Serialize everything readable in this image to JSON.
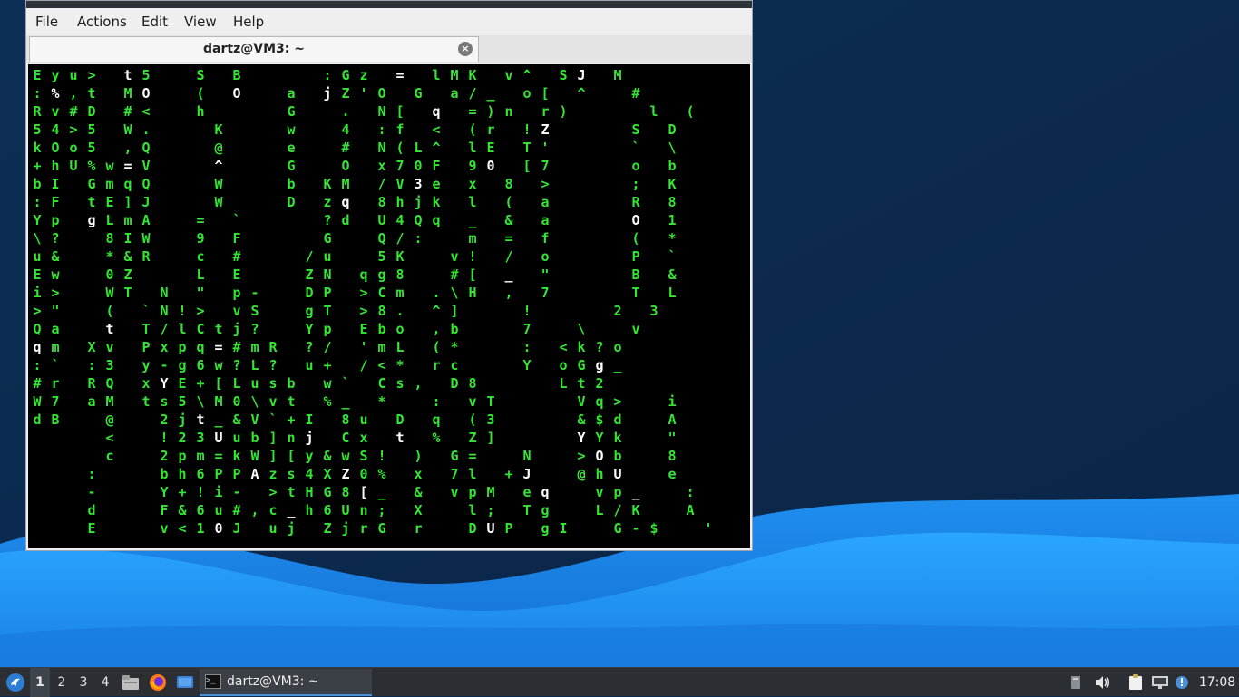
{
  "window": {
    "menu": [
      "File",
      "Actions",
      "Edit",
      "View",
      "Help"
    ],
    "tab_title": "dartz@VM3: ~",
    "tab_close_icon": "close-icon"
  },
  "terminal": {
    "rows": 26,
    "columns": [
      {
        "lines": [
          "E",
          ":",
          "R",
          "5",
          "k",
          "+",
          "b",
          ":",
          "Y",
          "\\",
          "u",
          "E",
          "i",
          ">",
          "Q",
          "q",
          ":",
          "#",
          "W",
          "d"
        ],
        "hi": [
          "d"
        ]
      },
      {
        "lines": [
          "y",
          "%",
          "v",
          "4",
          "O",
          "h",
          "I",
          "F",
          "p",
          "?",
          "&",
          "w",
          ">",
          "\"",
          "a",
          "m",
          "`",
          "r",
          "7",
          "B"
        ],
        "hi": [
          "B"
        ]
      },
      {
        "lines": [
          "u",
          ",",
          "#",
          ">",
          "o",
          "U"
        ],
        "hi": [
          "U"
        ],
        "start": 0
      },
      {
        "lines": [
          ">",
          "t",
          "D",
          "5",
          "5",
          "%",
          "G",
          "t",
          "L",
          "8",
          "*",
          "0",
          "W",
          "(",
          "t",
          "v",
          "3",
          "Q",
          "M"
        ],
        "start": 0
      },
      {
        "lines": [
          "t",
          "M",
          "#",
          "W",
          ",",
          "w",
          "m",
          "E",
          "m",
          "I",
          "&",
          "Z",
          "T"
        ],
        "start": 0
      },
      {
        "lines": [
          "5",
          "O",
          "<",
          ".",
          "Q",
          "V",
          "@",
          "J",
          "A",
          "W",
          "R"
        ],
        "start": 0
      }
    ],
    "grid_text": [
      "Eyu> t5  S B    :Gz = lMK v^ SJ M ",
      ":%,t MO  ( O  a jZ'O G a/_ o[ ^  # ",
      "Rv#D #<  h    G  . N[ q =)n r)    l (",
      "54>5 W.   K   w  4 :f < (r !Z    S D",
      "kOo5 ,Q   @   e  # N(L^ lE T'    ` \\",
      "+hU%w=V   ^   G  O x70F 90 [7    o b",
      "bI GmqQ   W   b KM /V3e x 8 >    ; K",
      ":F tE]J   W   D zq 8hjk l ( a    R 8",
      "Yp gLmA  = `    ?d U4Qq _ & a    O 1",
      "\\?  8IW  9 F    G  Q/:  m = f    ( *",
      "u&  *&R  c #   /u  5K  v! / o    P `",
      "Ew  0Z   L E   ZN qg8  #[ _ \"    B &",
      "i>  WT N \" p-  DP >Cm .\\H , 7    T L",
      ">\"  ( `N!> vS  gT >8. ^]   !    2 3",
      "Qa  t T/lCtj?  Yp Ebo ,b   7  \\  v ",
      "qm Xv Pxpq=#mR ?/ 'mL (*   : <k?o ",
      ":` :3 y-g6w?L? u+ /<* rc   Y oGg_ ",
      "#r RQ xYE+[Lusb w` Cs, D8    Lt2  ",
      "W7 aM ts5\\M0\\vt %_ *  : vT    Vq>  i",
      "dB  @  2jt_&V`+I 8u D q (3    &$d  A",
      "    <  !23Uub]nj Cx t % Z]    YYk  \"",
      "    c  2pm=kW][y&wS! ) G=  N  >Ob  8",
      "   :   bh6PPAzs4XZ0% x 7l +J  @hU  e",
      "   -   Y+!i- >tHG8[_ & vpM eq  vp_  :",
      "   d   F&6u#,c_h6Un; X  l; Tg  L/K  A",
      "   E   v<10J uj ZjrG r  DUP gI  G-$  '"
    ]
  },
  "taskbar": {
    "start_icon": "start-menu-icon",
    "workspaces": [
      "1",
      "2",
      "3",
      "4"
    ],
    "active_workspace": "1",
    "launchers": [
      "file-manager-icon",
      "firefox-icon",
      "desktop-icon"
    ],
    "task_label": "dartz@VM3: ~",
    "tray_icons": [
      "disk-icon",
      "volume-icon",
      "clipboard-icon",
      "network-icon",
      "notification-icon"
    ],
    "clock": "17:08"
  },
  "colors": {
    "terminal_green": "#34e534",
    "terminal_bg": "#000000",
    "taskbar_bg": "#2b2e33",
    "desktop_blue": "#1b8ef0"
  }
}
